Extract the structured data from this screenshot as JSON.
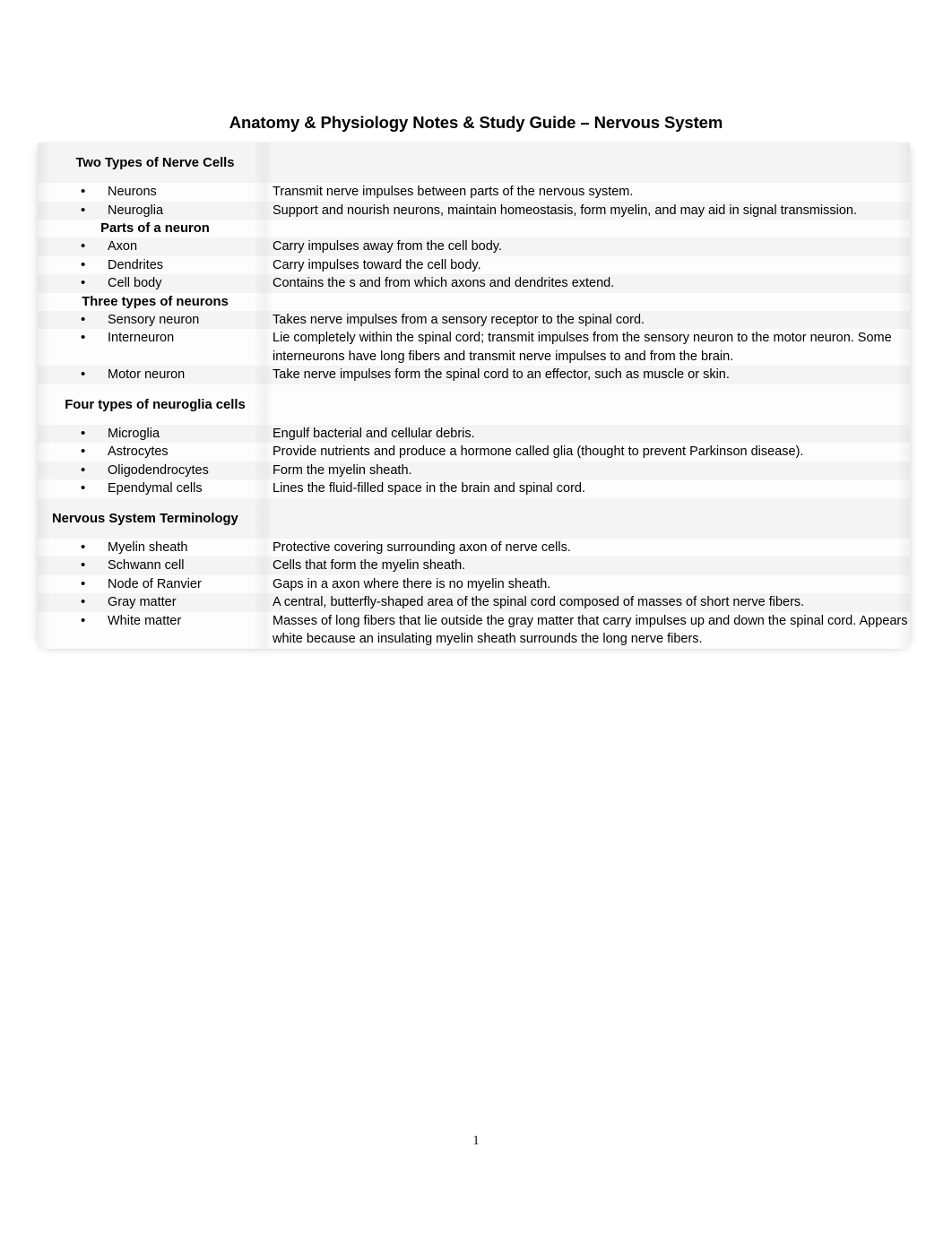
{
  "document": {
    "title": "Anatomy & Physiology Notes & Study Guide – Nervous System",
    "page_number": "1"
  },
  "table": {
    "sections": [
      {
        "heading": "Two Types of Nerve Cells",
        "heading_align": "center",
        "rows": [
          {
            "term": "Neurons",
            "description": "Transmit nerve impulses between parts of the nervous system."
          },
          {
            "term": "Neuroglia",
            "description": "Support and nourish neurons, maintain homeostasis, form myelin, and may aid in signal transmission."
          }
        ]
      },
      {
        "heading": "Parts of a neuron",
        "heading_align": "center",
        "rows": [
          {
            "term": "Axon",
            "description": "Carry impulses away from the cell body."
          },
          {
            "term": "Dendrites",
            "description": "Carry impulses toward the cell body."
          },
          {
            "term": "Cell body",
            "description": "Contains the s and from which axons and dendrites extend."
          }
        ]
      },
      {
        "heading": "Three types of neurons",
        "heading_align": "center",
        "rows": [
          {
            "term": "Sensory neuron",
            "description": "Takes nerve impulses from a sensory receptor to the spinal cord."
          },
          {
            "term": "Interneuron",
            "description": "Lie completely within the spinal cord; transmit impulses from the sensory neuron to the motor neuron. Some interneurons have long fibers and transmit nerve impulses to and from the brain."
          },
          {
            "term": "Motor neuron",
            "description": "Take nerve impulses form the spinal cord to an effector, such as muscle or skin."
          }
        ]
      },
      {
        "heading": "Four types of neuroglia cells",
        "heading_align": "center",
        "rows": [
          {
            "term": "Microglia",
            "description": "Engulf bacterial and cellular debris."
          },
          {
            "term": "Astrocytes",
            "description": "Provide nutrients and produce a hormone called glia (thought to prevent Parkinson disease)."
          },
          {
            "term": "Oligodendrocytes",
            "description": "Form the myelin sheath."
          },
          {
            "term": "Ependymal cells",
            "description": "Lines the fluid-filled space in the brain and spinal cord."
          }
        ]
      },
      {
        "heading": "Nervous System Terminology",
        "heading_align": "left",
        "rows": [
          {
            "term": "Myelin sheath",
            "description": "Protective covering surrounding axon of nerve cells."
          },
          {
            "term": "Schwann cell",
            "description": "Cells that form the myelin sheath."
          },
          {
            "term": "Node of Ranvier",
            "description": "Gaps in a axon where there is no myelin sheath."
          },
          {
            "term": "Gray matter",
            "description": "A central, butterfly-shaped area of the spinal cord composed of masses of short nerve fibers."
          },
          {
            "term": "White matter",
            "description": "Masses of long fibers that lie outside the gray matter that carry impulses up and down the spinal cord. Appears white because an insulating myelin sheath surrounds the long nerve fibers."
          }
        ]
      }
    ],
    "bullet_glyph": "•"
  }
}
